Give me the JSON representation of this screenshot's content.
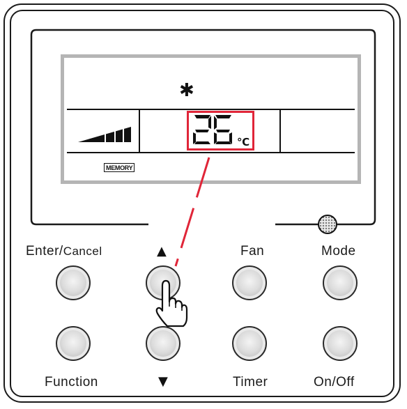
{
  "display": {
    "temperature": "26",
    "unit": "℃",
    "memory_label": "MEMORY",
    "mode_icon": "snowflake-icon",
    "fan_speed_bars": 4,
    "highlight_color": "#e02538"
  },
  "buttons": {
    "enter_cancel": {
      "label_main": "Enter",
      "label_sep": "/",
      "label_small": "Cancel"
    },
    "up": {
      "label": "▲",
      "icon": "pointing-hand-icon"
    },
    "fan": {
      "label": "Fan"
    },
    "mode": {
      "label": "Mode"
    },
    "function": {
      "label": "Function"
    },
    "down": {
      "label": "▼"
    },
    "timer": {
      "label": "Timer"
    },
    "on_off": {
      "label": "On/Off"
    }
  }
}
